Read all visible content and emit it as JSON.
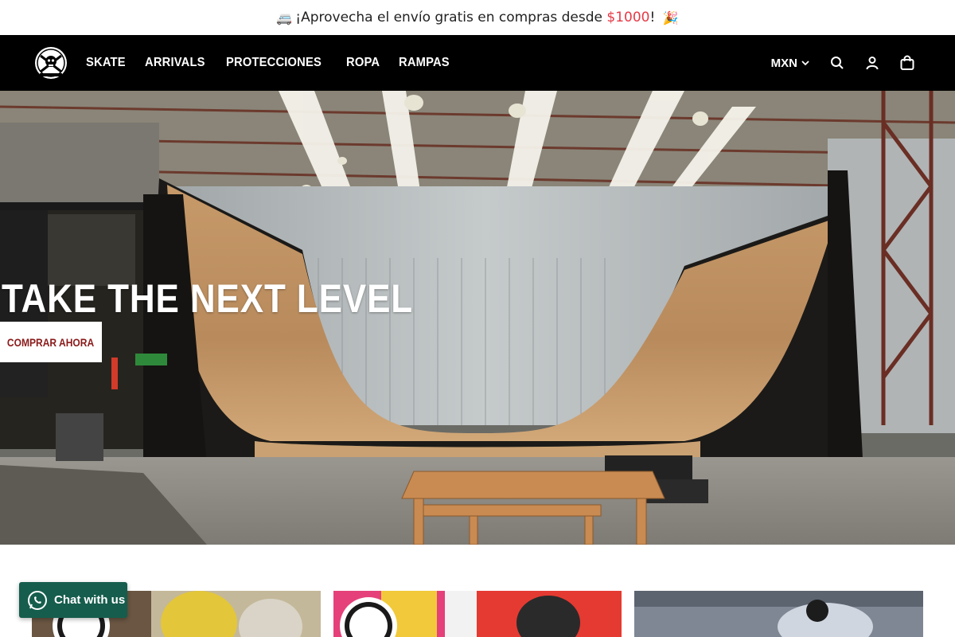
{
  "announcement": {
    "emoji_left": "🚐",
    "text_before": "¡Aprovecha el envío gratis en compras desde ",
    "price": "$1000",
    "text_after": "! ",
    "emoji_right": "🎉"
  },
  "nav": {
    "items": [
      {
        "label": "SKATE"
      },
      {
        "label": "ARRIVALS"
      },
      {
        "label": "PROTECCIONES"
      },
      {
        "label": "ROPA"
      },
      {
        "label": "RAMPAS"
      }
    ],
    "currency": "MXN"
  },
  "hero": {
    "title": "TAKE THE NEXT LEVEL",
    "button_label": "COMPRAR AHORA"
  },
  "chat": {
    "label": "Chat with us"
  },
  "colors": {
    "accent_price": "#e63946",
    "nav_bg": "#000000",
    "chat_bg": "#165d4d",
    "button_text": "#8a1a1a"
  }
}
